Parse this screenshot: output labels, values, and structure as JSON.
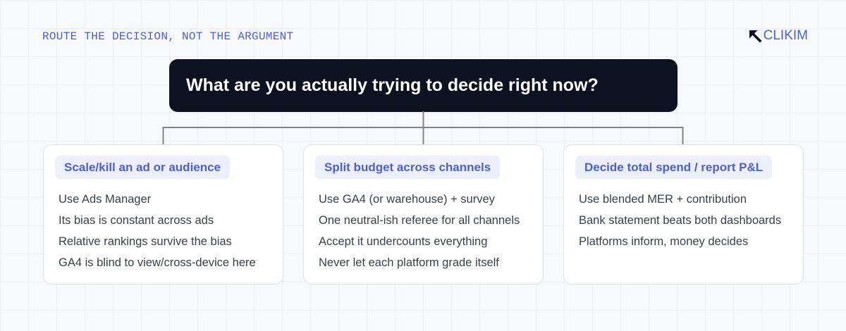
{
  "kicker": "ROUTE THE DECISION, NOT THE ARGUMENT",
  "logo": {
    "text": "CLIKIM",
    "icon": "arrow-up-left-icon"
  },
  "question": "What are you actually trying to decide right now?",
  "colors": {
    "accent": "#4f5fd6",
    "question_bg": "#0d1220",
    "pill_bg": "#eceffc",
    "connector": "#7a8494",
    "body_text": "#3a3f4c"
  },
  "branches": [
    {
      "title": "Scale/kill an ad or audience",
      "lines": [
        "Use Ads Manager",
        "Its bias is constant across ads",
        "Relative rankings survive the bias",
        "GA4 is blind to view/cross-device here"
      ]
    },
    {
      "title": "Split budget across channels",
      "lines": [
        "Use GA4 (or warehouse) + survey",
        "One neutral-ish referee for all channels",
        "Accept it undercounts everything",
        "Never let each platform grade itself"
      ]
    },
    {
      "title": "Decide total spend / report P&L",
      "lines": [
        "Use blended MER + contribution",
        "Bank statement beats both dashboards",
        "Platforms inform, money decides"
      ]
    }
  ]
}
